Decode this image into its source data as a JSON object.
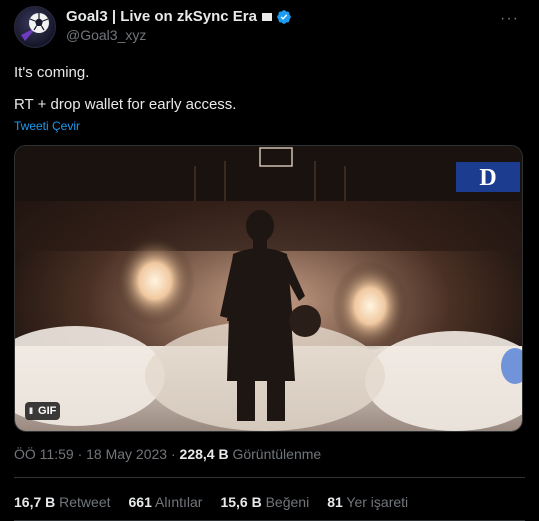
{
  "author": {
    "display_name": "Goal3 | Live on zkSync Era",
    "handle": "@Goal3_xyz"
  },
  "tweet": {
    "line1": "It's coming.",
    "line2": "RT + drop wallet for early access.",
    "translate_label": "Tweeti Çevir"
  },
  "media": {
    "badge": "GIF",
    "pause_label": "II",
    "team_logo_icon": "duke-d-logo"
  },
  "meta": {
    "time": "ÖÖ 11:59",
    "dot1": "·",
    "date": "18 May 2023",
    "dot2": "·",
    "views_count": "228,4 B",
    "views_label": "Görüntülenme"
  },
  "stats": {
    "retweets": {
      "count": "16,7 B",
      "label": "Retweet"
    },
    "quotes": {
      "count": "661",
      "label": "Alıntılar"
    },
    "likes": {
      "count": "15,6 B",
      "label": "Beğeni"
    },
    "bookmarks": {
      "count": "81",
      "label": "Yer işareti"
    }
  },
  "colors": {
    "background": "#000000",
    "text": "#e7e9ea",
    "secondary": "#71767b",
    "link": "#1d9bf0",
    "verified": "#1d9bf0",
    "divider": "#2f3336"
  }
}
